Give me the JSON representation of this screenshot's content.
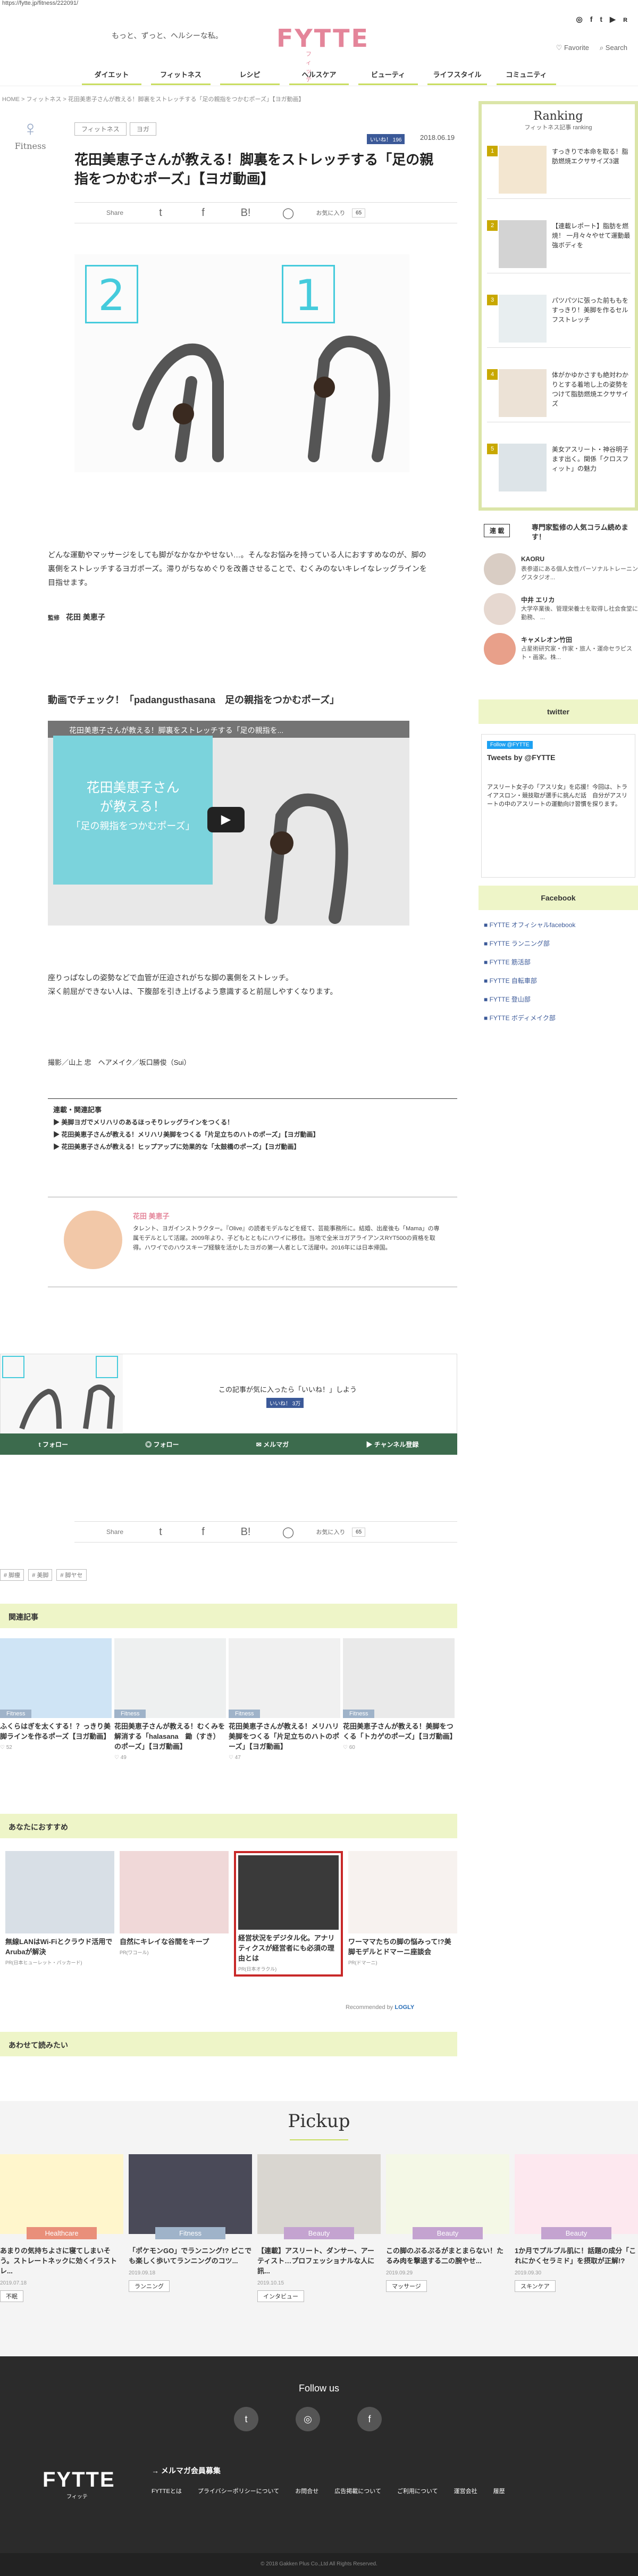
{
  "url": "https://fytte.jp/fitness/222091/",
  "header": {
    "tagline": "もっと、ずっと、ヘルシーな私。",
    "logo": "FYTTE",
    "logo_sub": "フィッテ",
    "favorite": "♡ Favorite",
    "search": "⌕ Search",
    "social": [
      "◎",
      "f",
      "t",
      "▶",
      "ʀ"
    ]
  },
  "nav": [
    "ダイエット",
    "フィットネス",
    "レシピ",
    "ヘルスケア",
    "ビューティ",
    "ライフスタイル",
    "コミュニティ"
  ],
  "breadcrumb": "HOME > フィットネス > 花田美恵子さんが教える！脚裏をストレッチする「足の親指をつかむポーズ」【ヨガ動画】",
  "article": {
    "category_label": "Fitness",
    "tags": [
      "フィットネス",
      "ヨガ"
    ],
    "like_count": "いいね！ 196",
    "date": "2018.06.19",
    "title": "花田美恵子さんが教える！脚裏をストレッチする「足の親指をつかむポーズ」【ヨガ動画】",
    "share_label": "Share",
    "fav_label": "お気に入り",
    "fav_count": "65",
    "hero_nums": [
      "2",
      "1"
    ],
    "intro": "どんな運動やマッサージをしても脚がなかなかやせない…。そんなお悩みを持っている人におすすめなのが、脚の裏側をストレッチするヨガポーズ。滞りがちなめぐりを改善させることで、むくみのないキレイなレッグラインを目指せます。",
    "supervisor_prefix": "監修",
    "supervisor": "花田 美恵子",
    "video_heading": "動画でチェック！「padangusthasana　足の親指をつかむポーズ」",
    "video_title": "花田美恵子さんが教える！脚裏をストレッチする「足の親指を...",
    "video_box": [
      "花田美恵子さん",
      "が教える！",
      "「足の親指をつかむポーズ」"
    ],
    "body_1": "座りっぱなしの姿勢などで血管が圧迫されがちな脚の裏側をストレッチ。",
    "body_2": "深く前屈ができない人は、下腹部を引き上げるよう意識すると前屈しやすくなります。",
    "credit": "撮影／山上 忠　ヘアメイク／坂口勝俊（Sui）",
    "related_title": "連載・関連記事",
    "related": [
      "美脚ヨガでメリハリのあるほっそりレッグラインをつくる！",
      "花田美恵子さんが教える！メリハリ美脚をつくる「片足立ちのハトのポーズ」【ヨガ動画】",
      "花田美恵子さんが教える！ヒップアップに効果的な「太鼓橋のポーズ」【ヨガ動画】"
    ],
    "author_name": "花田 美恵子",
    "author_bio": "タレント、ヨガインストラクター。『Olive』の読者モデルなどを経て、芸能事務所に。結婚、出産後も「Mama」の専属モデルとして活躍。2009年より、子どもとともにハワイに移住。当地で全米ヨガアライアンスRYT500の資格を取得。ハワイでのハウスキープ経験を活かしたヨガの第一人者として活躍中。2016年には日本帰国。",
    "cta_text": "この記事が気に入ったら「いいね！」しよう",
    "cta_like": "いいね！ 3万",
    "cta_buttons": [
      "フォロー",
      "フォロー",
      "メルマガ",
      "チャンネル登録"
    ],
    "tags_bottom": [
      "# 脚痩",
      "# 美脚",
      "# 脚ヤセ"
    ]
  },
  "sections": {
    "related": "関連記事",
    "recommend": "あなたにおすすめ",
    "also": "あわせて読みたい",
    "pickup": "Pickup",
    "recommended_by": "Recommended by",
    "logly": "LOGLY"
  },
  "related_cards": [
    {
      "title": "ふくらはぎを太くする！？っきり美脚ラインを作るポーズ【ヨガ動画】",
      "cat": "Fitness",
      "count": "52"
    },
    {
      "title": "花田美恵子さんが教える！むくみを解消する「halasana　鋤（すき）のポーズ」【ヨガ動画】",
      "cat": "Fitness",
      "count": "49"
    },
    {
      "title": "花田美恵子さんが教える！メリハリ美脚をつくる「片足立ちのハトのポーズ」【ヨガ動画】",
      "cat": "Fitness",
      "count": "47"
    },
    {
      "title": "花田美恵子さんが教える！美脚をつくる「トカゲのポーズ」【ヨガ動画】",
      "cat": "Fitness",
      "count": "60"
    }
  ],
  "recommend_cards": [
    {
      "title": "無線LANはWi-Fiとクラウド活用でArubaが解決",
      "src": "PR(日本ヒューレット・パッカード)"
    },
    {
      "title": "自然にキレイな谷間をキープ",
      "src": "PR(ワコール)"
    },
    {
      "title": "経営状況をデジタル化。アナリティクスが経営者にも必須の理由とは",
      "src": "PR(日本オラクル)"
    },
    {
      "title": "ワーママたちの脚の悩みって!?美脚モデルとドマーニ座談会",
      "src": "PR(ドマーニ)"
    }
  ],
  "pickup": [
    {
      "title": "あまりの気持ちよさに寝てしまいそう。ストレートネックに効くイラストレ...",
      "cat": "Healthcare",
      "cat_color": "#e98f7a",
      "date": "2019.07.18",
      "tag": "不眠"
    },
    {
      "title": "「ポケモンGO」でランニング!? ピこでも楽しく歩いてランニングのコツ...",
      "cat": "Fitness",
      "cat_color": "#9fb3c9",
      "date": "2019.09.18",
      "tag": "ランニング"
    },
    {
      "title": "【連載】アスリート、ダンサー、アーティスト…プロフェッショナルな人に訊...",
      "cat": "Beauty",
      "cat_color": "#c4a3d0",
      "date": "2019.10.15",
      "tag": "インタビュー"
    },
    {
      "title": "この脚のぷるぷるがまとまらない！たるみ肉を撃退する二の腕やせ...",
      "cat": "Beauty",
      "cat_color": "#c4a3d0",
      "date": "2019.09.29",
      "tag": "マッサージ"
    },
    {
      "title": "1か月でプルプル肌に！話題の成分「これにかくセラミド」を摂取が正解!?",
      "cat": "Beauty",
      "cat_color": "#c4a3d0",
      "date": "2019.09.30",
      "tag": "スキンケア"
    }
  ],
  "footer": {
    "follow": "Follow us",
    "icons": [
      "t",
      "◎",
      "f"
    ],
    "logo": "FYTTE",
    "logo_sub": "フィッテ",
    "mail": "→ メルマガ会員募集",
    "links": [
      "FYTTEとは",
      "プライバシーポリシーについて",
      "お問合せ",
      "広告掲載について",
      "ご利用について",
      "運営会社",
      "履歴"
    ],
    "copyright": "© 2018 Gakken Plus Co.,Ltd All Rights Reserved."
  },
  "sidebar": {
    "ranking_title": "Ranking",
    "ranking_sub": "フィットネス記事 ranking",
    "ranking_items": [
      {
        "num": "1",
        "title": "すっきりで本命を取る！脂肪燃焼エクササイズ3選"
      },
      {
        "num": "2",
        "title": "【連載レポート】脂肪を燃焼！ 一月々々やせて運動最強ボディを"
      },
      {
        "num": "3",
        "title": "パツパツに張った前ももをすっきり！美脚を作るセルフストレッチ"
      },
      {
        "num": "4",
        "title": "体がかゆかさすも絶対わかりとする着地し上の姿勢をつけて脂肪燃焼エクササイズ"
      },
      {
        "num": "5",
        "title": "美女アスリート・神谷明子ます出く。関係「クロスフィット」の魅力"
      }
    ],
    "experts_label": "連 載",
    "experts_heading": "専門家監修の人気コラム続めます！",
    "experts": [
      {
        "name": "KAORU",
        "desc": "表参道にある個人女性パーソナルトレーニングスタジオ..."
      },
      {
        "name": "中井 エリカ",
        "desc": "大学卒業後、管理栄養士を取得し社会食堂に勤務、 ..."
      },
      {
        "name": "キャメレオン竹田",
        "desc": "占星術研究家・作家・旅人・運命セラピスト・画家。株..."
      }
    ],
    "twitter_title": "twitter",
    "tweets_label": "Tweets by @FYTTE",
    "tweet_text": "アスリート女子の「アスリ女」を応援！今回は、トライアスロン・競技取が選手に挑んだ話　自分がアスリートの中のアスリートの運動向け習慣を探ります。",
    "facebook_title": "Facebook",
    "facebook_links": [
      "FYTTE オフィシャルfacebook",
      "FYTTE ランニング部",
      "FYTTE 筋活部",
      "FYTTE 自転車部",
      "FYTTE 登山部",
      "FYTTE ボディメイク部"
    ]
  }
}
